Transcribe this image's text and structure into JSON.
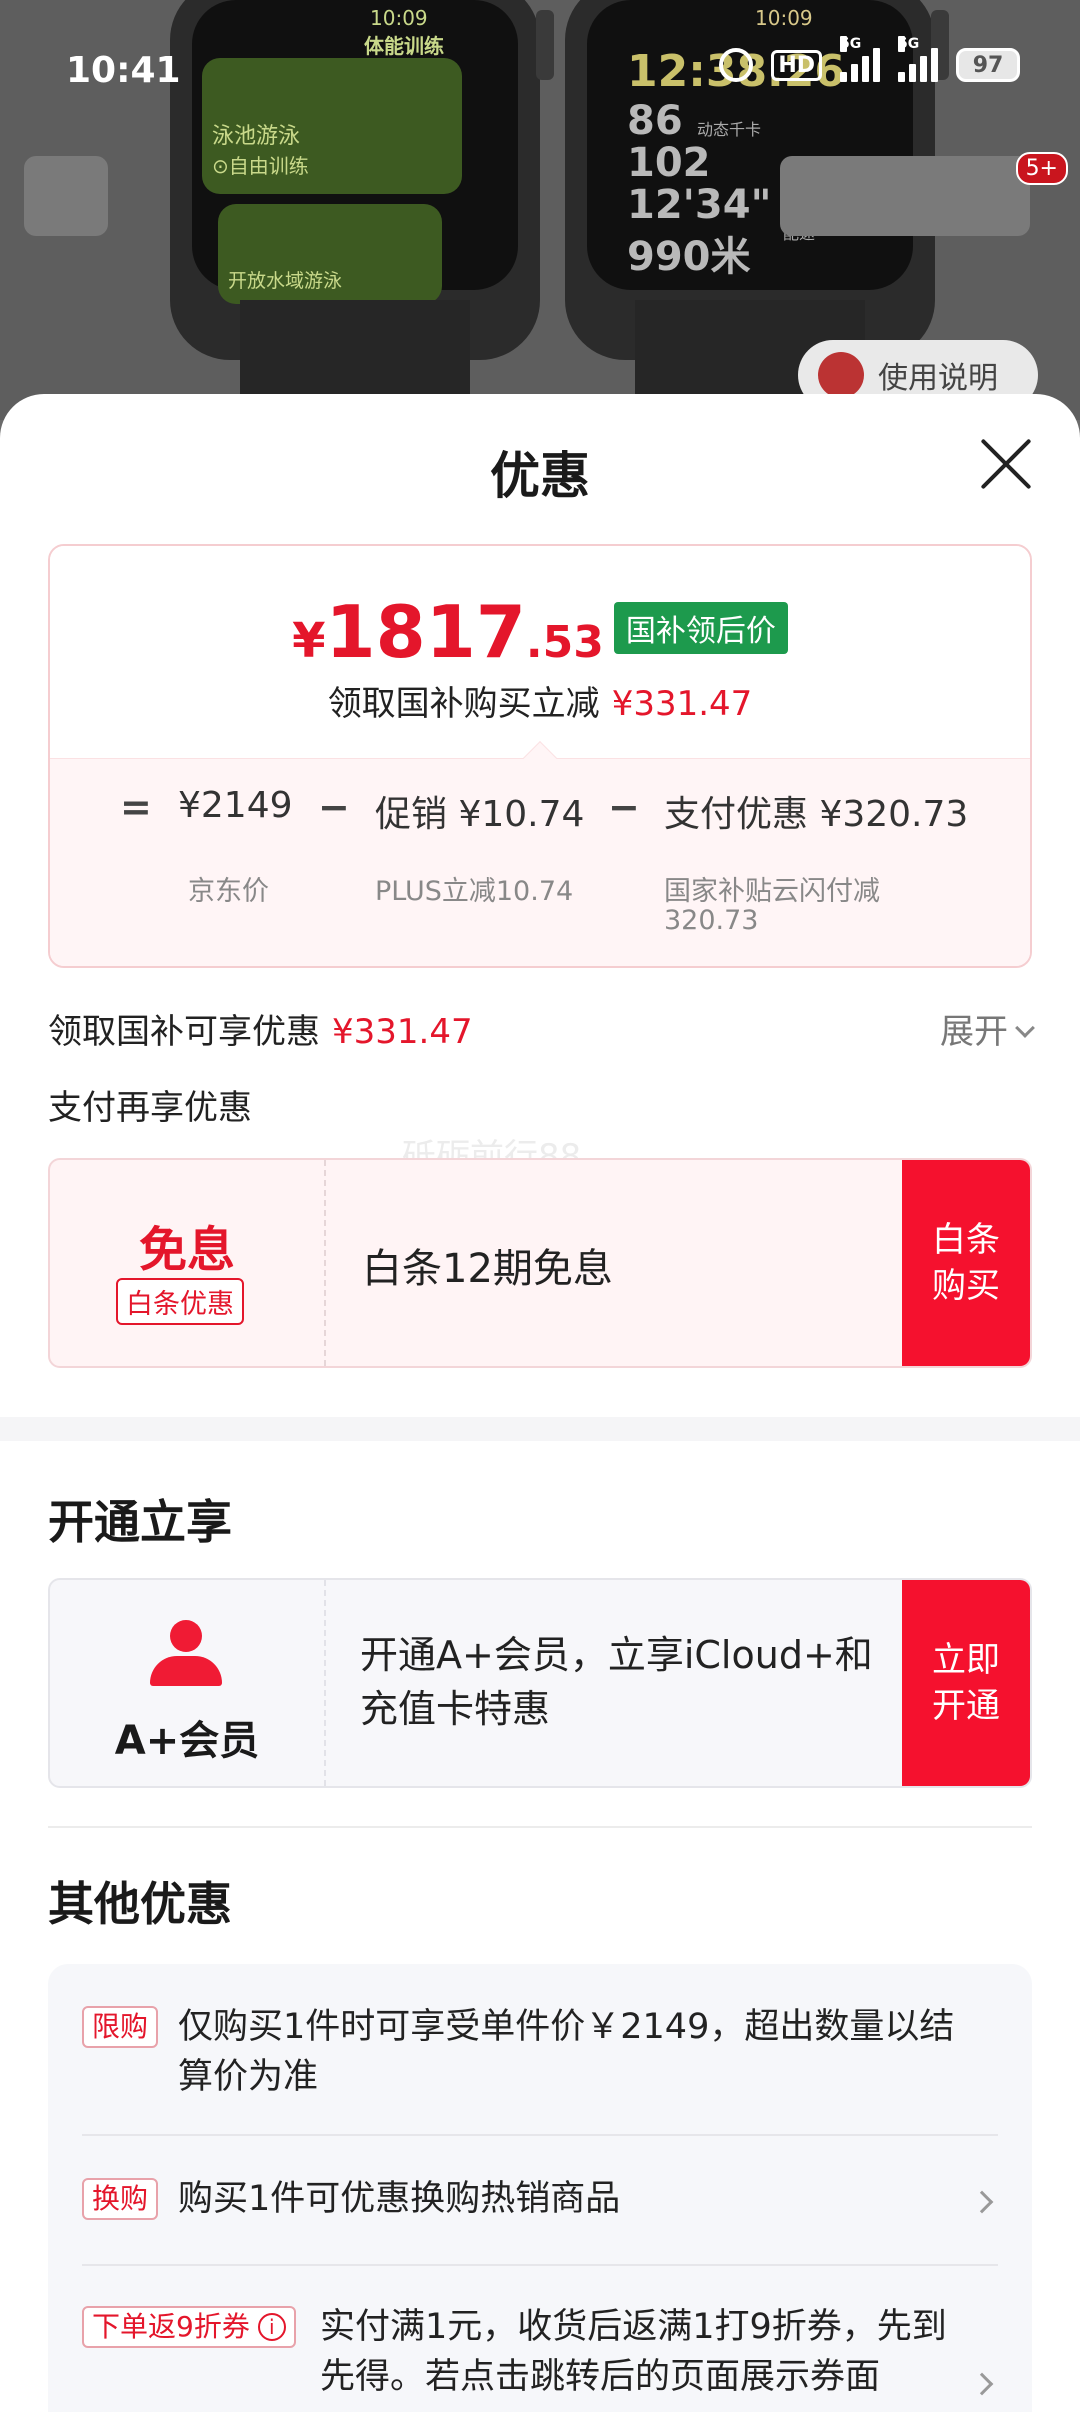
{
  "status_bar": {
    "time": "10:41",
    "hd_label": "HD",
    "signal1_label": "5G",
    "signal2_label": "5G",
    "battery": "97"
  },
  "background": {
    "watch1_time": "10:09",
    "watch1_header": "体能训练",
    "watch1_item1": "泳池游泳",
    "watch1_item1_sub": "⊙自由训练",
    "watch1_item2": "开放水域游泳",
    "watch2_time": "10:09",
    "watch2_clock": "12:38.26",
    "watch2_stat1": "86",
    "watch2_stat1_unit": "动态千卡",
    "watch2_stat2": "102",
    "watch2_stat3": "12'34\"",
    "watch2_stat3_unit": "平均配速",
    "watch2_stat4": "990米",
    "cart_badge": "5+",
    "usage_pill": "使用说明"
  },
  "sheet": {
    "title": "优惠",
    "price_card": {
      "currency": "¥",
      "price_int": "1817",
      "price_dec": ".53",
      "price_tag": "国补领后价",
      "sub_label": "领取国补购买立减",
      "sub_amount": "¥331.47",
      "equals": "=",
      "minus": "−",
      "jd_value": "¥2149",
      "jd_label": "京东价",
      "promo_value": "促销 ¥10.74",
      "promo_label": "PLUS立减10.74",
      "pay_value": "支付优惠 ¥320.73",
      "pay_label_line1": "国家补贴云闪付减",
      "pay_label_line2": "320.73"
    },
    "subsidy_label": "领取国补可享优惠",
    "subsidy_amount": "¥331.47",
    "expand_label": "展开",
    "pay_more_label": "支付再享优惠",
    "watermark": "砥砺前行88",
    "baitiao": {
      "main": "免息",
      "tag": "白条优惠",
      "text": "白条12期免息",
      "cta": "白条购买"
    },
    "open_section_title": "开通立享",
    "membership": {
      "label": "A+会员",
      "text": "开通A+会员，立享iCloud+和充值卡特惠",
      "cta": "立即开通"
    },
    "other_section_title": "其他优惠",
    "other_items": [
      {
        "tag": "限购",
        "text": "仅购买1件时可享受单件价￥2149，超出数量以结算价为准"
      },
      {
        "tag": "换购",
        "text": "购买1件可优惠换购热销商品"
      },
      {
        "tag": "下单返9折券",
        "tag_icon": "i",
        "text": "实付满1元，收货后返满1打9折券，先到先得。若点击跳转后的页面展示券面"
      }
    ]
  },
  "colors": {
    "accent_red": "#e4162b",
    "cta_red": "#f5112e",
    "green_tag": "#1d9a4d"
  }
}
